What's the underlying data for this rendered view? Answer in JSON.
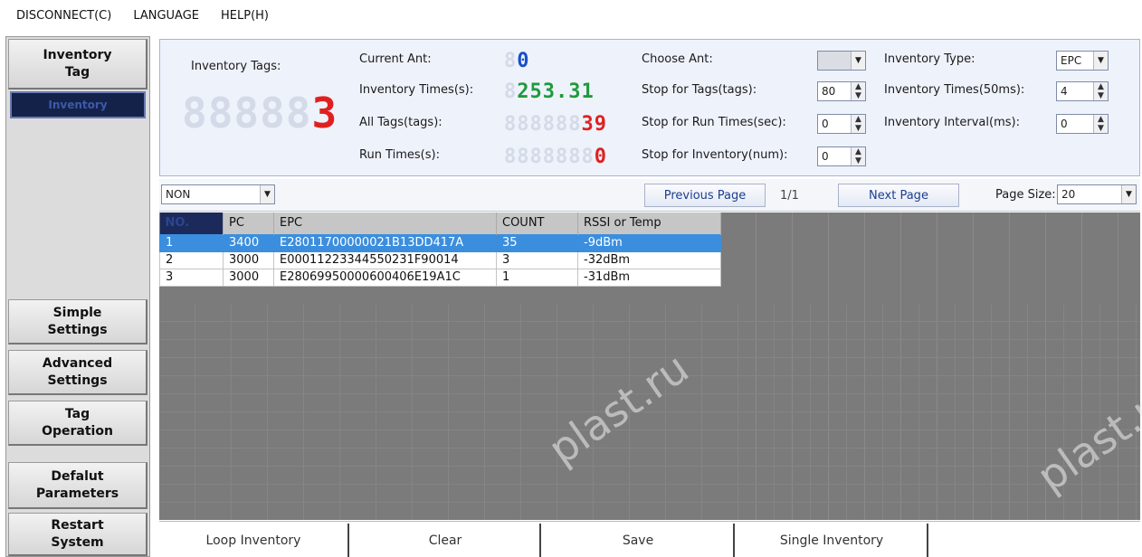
{
  "menu": {
    "disconnect": "DISCONNECT(C)",
    "language": "LANGUAGE",
    "help": "HELP(H)"
  },
  "nav": {
    "inventory_tag": "Inventory\nTag",
    "inventory_sub": "Inventory",
    "simple_settings": "Simple\nSettings",
    "advanced_settings": "Advanced\nSettings",
    "tag_operation": "Tag\nOperation",
    "default_parameters": "Defalut\nParameters",
    "restart_system": "Restart\nSystem"
  },
  "panel": {
    "inventory_tags_label": "Inventory Tags:",
    "inventory_tags_value": "3",
    "current_ant_label": "Current Ant:",
    "current_ant_value": "0",
    "inventory_times_label": "Inventory Times(s):",
    "inventory_times_value": "253.31",
    "all_tags_label": "All Tags(tags):",
    "all_tags_value": "39",
    "run_times_label": "Run Times(s):",
    "run_times_value": "0",
    "choose_ant_label": "Choose Ant:",
    "choose_ant_value": "",
    "stop_tags_label": "Stop for Tags(tags):",
    "stop_tags_value": "80",
    "stop_run_label": "Stop for Run Times(sec):",
    "stop_run_value": "0",
    "stop_inventory_label": "Stop for Inventory(num):",
    "stop_inventory_value": "0",
    "inventory_type_label": "Inventory Type:",
    "inventory_type_value": "EPC",
    "inventory_times50_label": "Inventory Times(50ms):",
    "inventory_times50_value": "4",
    "inventory_interval_label": "Inventory Interval(ms):",
    "inventory_interval_value": "0"
  },
  "toolbar": {
    "filter_value": "NON",
    "previous_page": "Previous Page",
    "page_indicator": "1/1",
    "next_page": "Next Page",
    "page_size_label": "Page Size:",
    "page_size_value": "20"
  },
  "table": {
    "headers": [
      "NO.",
      "PC",
      "EPC",
      "COUNT",
      "RSSI or Temp"
    ],
    "rows": [
      [
        "1",
        "3400",
        "E28011700000021B13DD417A",
        "35",
        "-9dBm"
      ],
      [
        "2",
        "3000",
        "E00011223344550231F90014",
        "3",
        "-32dBm"
      ],
      [
        "3",
        "3000",
        "E28069950000600406E19A1C",
        "1",
        "-31dBm"
      ]
    ],
    "selected_row": 0
  },
  "actions": {
    "loop_inventory": "Loop Inventory",
    "clear": "Clear",
    "save": "Save",
    "single_inventory": "Single Inventory"
  },
  "watermarks": [
    "plast.ru",
    "plast.ru"
  ],
  "icons": {
    "spinner": "spinner-arrows-icon",
    "dropdown": "chevron-down-icon"
  },
  "colors": {
    "seg_red": "#e02020",
    "seg_green": "#1f9a3c",
    "seg_blue": "#1a4fc8",
    "selected_row": "#3b8ede",
    "nav_active": "#14224a"
  }
}
